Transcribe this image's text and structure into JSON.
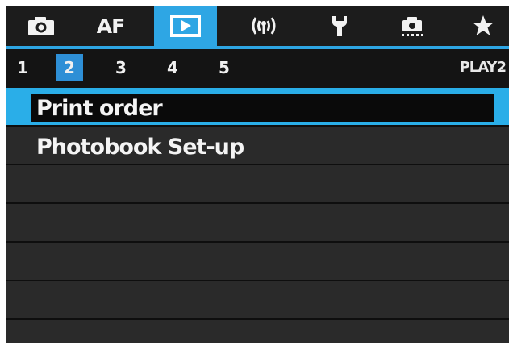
{
  "tabs": [
    {
      "id": "shooting",
      "icon": "camera-icon",
      "label": ""
    },
    {
      "id": "af",
      "icon": "",
      "label": "AF"
    },
    {
      "id": "playback",
      "icon": "playback-icon",
      "label": "",
      "active": true
    },
    {
      "id": "wireless",
      "icon": "wireless-icon",
      "label": "(ᵠ)"
    },
    {
      "id": "setup",
      "icon": "wrench-icon",
      "label": ""
    },
    {
      "id": "custom",
      "icon": "custom-functions-icon",
      "label": ""
    },
    {
      "id": "mymenu",
      "icon": "star-icon",
      "label": "★"
    }
  ],
  "subtabs": [
    "1",
    "2",
    "3",
    "4",
    "5"
  ],
  "active_subtab": "2",
  "page_label": "PLAY2",
  "menu_items": [
    "Print order",
    "Photobook Set-up",
    "",
    "",
    "",
    "",
    ""
  ],
  "selected_item": "Print order",
  "colors": {
    "accent": "#2ea6e4",
    "background": "#262626"
  }
}
